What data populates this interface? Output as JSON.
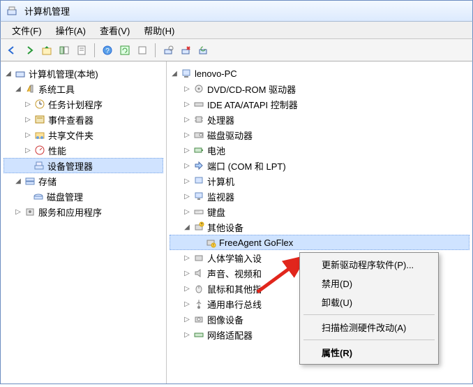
{
  "window": {
    "title": "计算机管理"
  },
  "menubar": {
    "file": "文件(F)",
    "action": "操作(A)",
    "view": "查看(V)",
    "help": "帮助(H)"
  },
  "left_tree": {
    "root": "计算机管理(本地)",
    "system_tools": "系统工具",
    "task_scheduler": "任务计划程序",
    "event_viewer": "事件查看器",
    "shared_folders": "共享文件夹",
    "performance": "性能",
    "device_manager": "设备管理器",
    "storage": "存储",
    "disk_management": "磁盘管理",
    "services_apps": "服务和应用程序"
  },
  "right_tree": {
    "pc": "lenovo-PC",
    "dvd": "DVD/CD-ROM 驱动器",
    "ide": "IDE ATA/ATAPI 控制器",
    "cpu": "处理器",
    "disk": "磁盘驱动器",
    "battery": "电池",
    "ports": "端口 (COM 和 LPT)",
    "computer": "计算机",
    "monitor": "监视器",
    "keyboard": "键盘",
    "other": "其他设备",
    "freeagent": "FreeAgent GoFlex",
    "hid": "人体学输入设",
    "sound": "声音、视频和",
    "mouse": "鼠标和其他指",
    "usb": "通用串行总线",
    "imaging": "图像设备",
    "network": "网络适配器"
  },
  "context_menu": {
    "update_driver": "更新驱动程序软件(P)...",
    "disable": "禁用(D)",
    "uninstall": "卸载(U)",
    "scan": "扫描检测硬件改动(A)",
    "properties": "属性(R)"
  }
}
